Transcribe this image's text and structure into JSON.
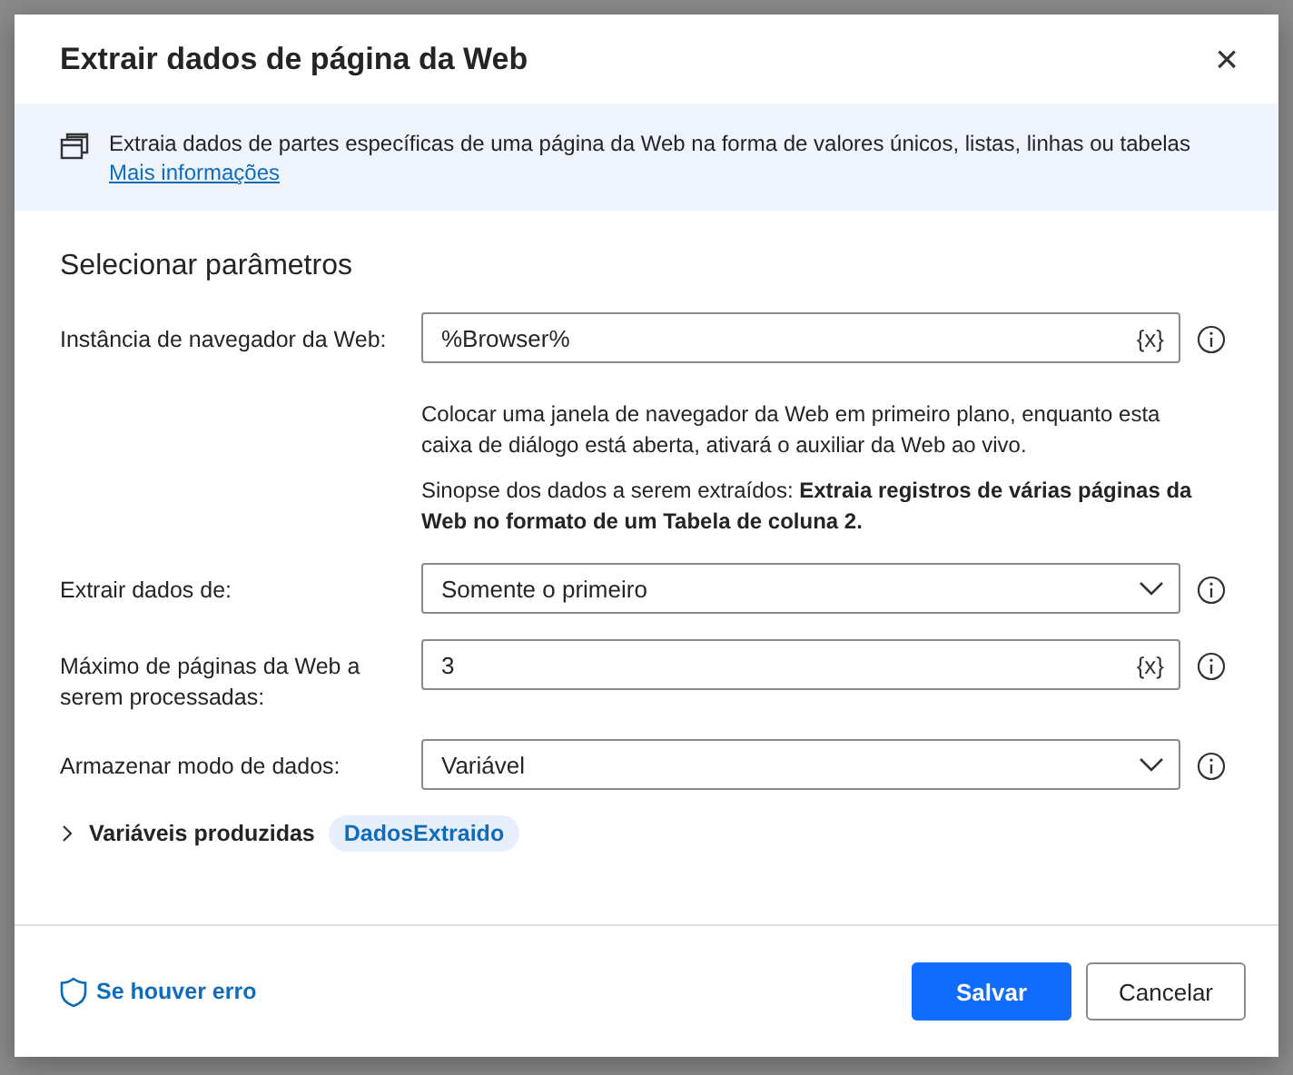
{
  "dialog": {
    "title": "Extrair dados de página da Web",
    "close_label": "×"
  },
  "banner": {
    "text": "Extraia dados de partes específicas de uma página da Web na forma de valores únicos, listas, linhas ou tabelas",
    "link": "Mais informações"
  },
  "section_title": "Selecionar parâmetros",
  "fields": [
    {
      "kind": "text",
      "label": "Instância de navegador da Web:",
      "value": "%Browser%",
      "var_token": "{x}",
      "notes": [
        "Colocar uma janela de navegador da Web em primeiro plano, enquanto esta caixa de diálogo está aberta, ativará o auxiliar da Web ao vivo.",
        "Sinopse dos dados a serem extraídos: **Extraia registros de várias páginas da Web no formato de um Tabela de coluna 2.**"
      ]
    },
    {
      "kind": "select",
      "label": "Extrair dados de:",
      "value": "Somente o primeiro"
    },
    {
      "kind": "text",
      "label": "Máximo de páginas da Web a serem processadas:",
      "value": "3",
      "var_token": "{x}"
    },
    {
      "kind": "select",
      "label": "Armazenar modo de dados:",
      "value": "Variável"
    }
  ],
  "produced_variables": {
    "label": "Variáveis produzidas",
    "expanded": false,
    "variables": [
      "DadosExtraido"
    ]
  },
  "footer": {
    "error_link": "Se houver erro",
    "buttons": [
      {
        "label": "Salvar",
        "primary": true
      },
      {
        "label": "Cancelar",
        "primary": false
      }
    ]
  }
}
